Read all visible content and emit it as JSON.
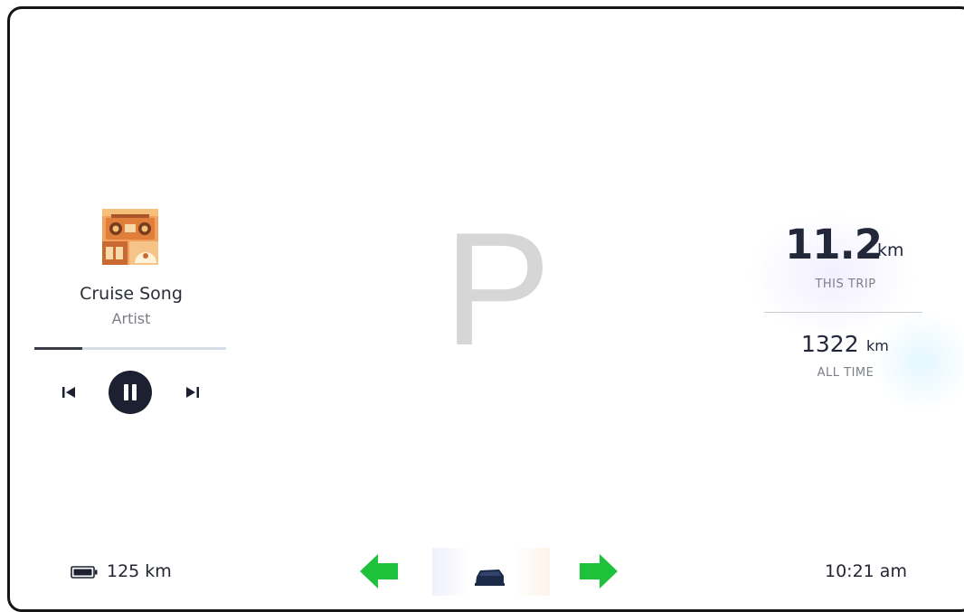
{
  "media": {
    "album_art_icon": "boombox-album-art",
    "title": "Cruise Song",
    "artist": "Artist",
    "progress": 0.25,
    "controls": {
      "prev_icon": "skip-previous-icon",
      "play_pause_icon": "pause-icon",
      "next_icon": "skip-next-icon"
    }
  },
  "gear": "P",
  "trip": {
    "this_trip_value": "11.2",
    "this_trip_unit": "km",
    "this_trip_label": "THIS TRIP",
    "all_time_value": "1322",
    "all_time_unit": "km",
    "all_time_label": "ALL TIME"
  },
  "status_bar": {
    "battery_icon": "battery-icon",
    "range": "125 km",
    "left_indicator_icon": "turn-left-arrow-icon",
    "car_icon": "car-icon",
    "right_indicator_icon": "turn-right-arrow-icon",
    "time": "10:21 am"
  },
  "colors": {
    "indicator_green": "#1ec23a",
    "dark": "#1c2030",
    "gear_gray": "#d6d6d6"
  }
}
